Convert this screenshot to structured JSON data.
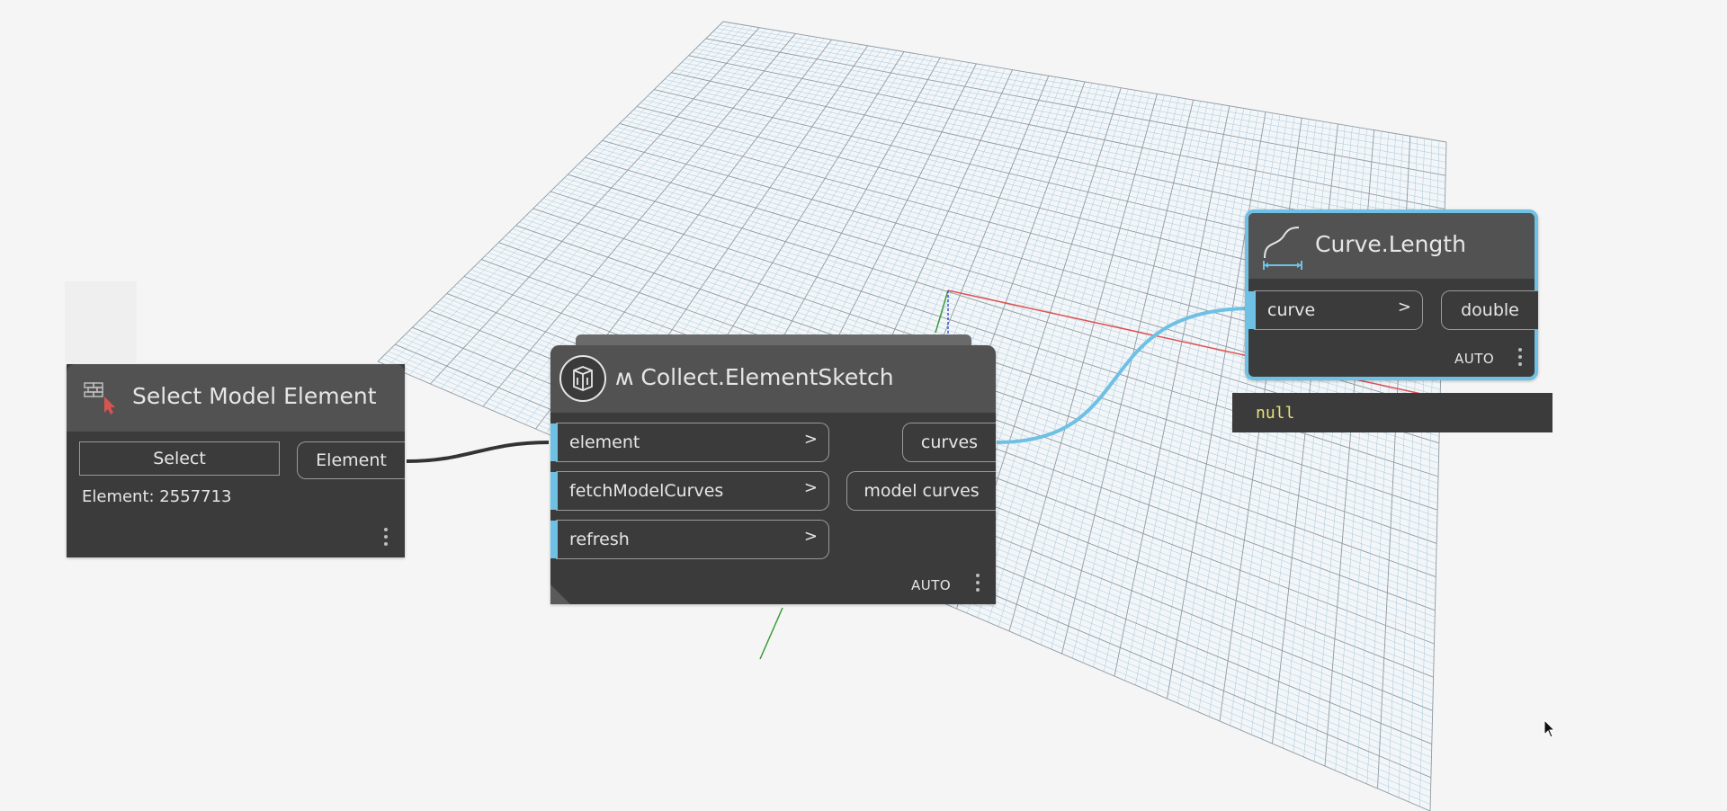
{
  "canvas": {
    "background": "#f5f5f5",
    "grid_color": "#a9c7d8",
    "grid_major_color": "#8f9aa3",
    "wire_dark": "#333333",
    "wire_selected": "#6ec1e4"
  },
  "nodes": {
    "select_model_element": {
      "title": "Select Model Element",
      "icon": "select-element-icon",
      "select_button": "Select",
      "output_port": "Element",
      "value": "Element: 2557713"
    },
    "collect_element_sketch": {
      "title": "ʍ Collect.ElementSketch",
      "icon": "collect-package-icon",
      "inputs": [
        {
          "label": "element",
          "chevron": ">"
        },
        {
          "label": "fetchModelCurves",
          "chevron": ">"
        },
        {
          "label": "refresh",
          "chevron": ">"
        }
      ],
      "outputs": [
        {
          "label": "curves"
        },
        {
          "label": "model curves"
        }
      ],
      "lacing": "AUTO"
    },
    "curve_length": {
      "title": "Curve.Length",
      "icon": "curve-length-icon",
      "inputs": [
        {
          "label": "curve",
          "chevron": ">"
        }
      ],
      "outputs": [
        {
          "label": "double"
        }
      ],
      "lacing": "AUTO",
      "preview": "null",
      "selected_color": "#6ec1e4"
    }
  }
}
